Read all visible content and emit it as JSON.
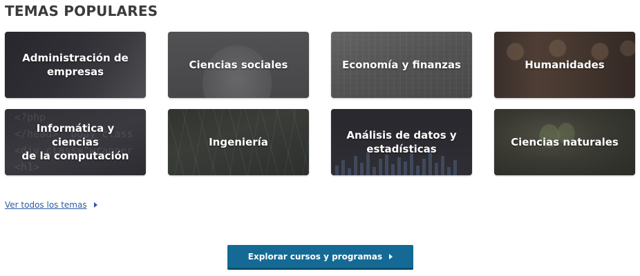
{
  "section": {
    "title": "TEMAS POPULARES"
  },
  "topics": [
    {
      "label": "Administración de\nempresas",
      "icon": "business-photo"
    },
    {
      "label": "Ciencias sociales",
      "icon": "person-photo"
    },
    {
      "label": "Economía y finanzas",
      "icon": "banknote-photo"
    },
    {
      "label": "Humanidades",
      "icon": "people-photo"
    },
    {
      "label": "Informática  y ciencias\nde la computación",
      "icon": "code-photo"
    },
    {
      "label": "Ingeniería",
      "icon": "structure-photo"
    },
    {
      "label": "Análisis de datos y\nestadísticas",
      "icon": "chart-photo"
    },
    {
      "label": "Ciencias naturales",
      "icon": "plant-photo"
    }
  ],
  "links": {
    "see_all": "Ver todos los temas"
  },
  "actions": {
    "explore": "Explorar cursos y programas"
  },
  "colors": {
    "link": "#2a5aa6",
    "button": "#146a94",
    "title": "#3b3b3b"
  }
}
